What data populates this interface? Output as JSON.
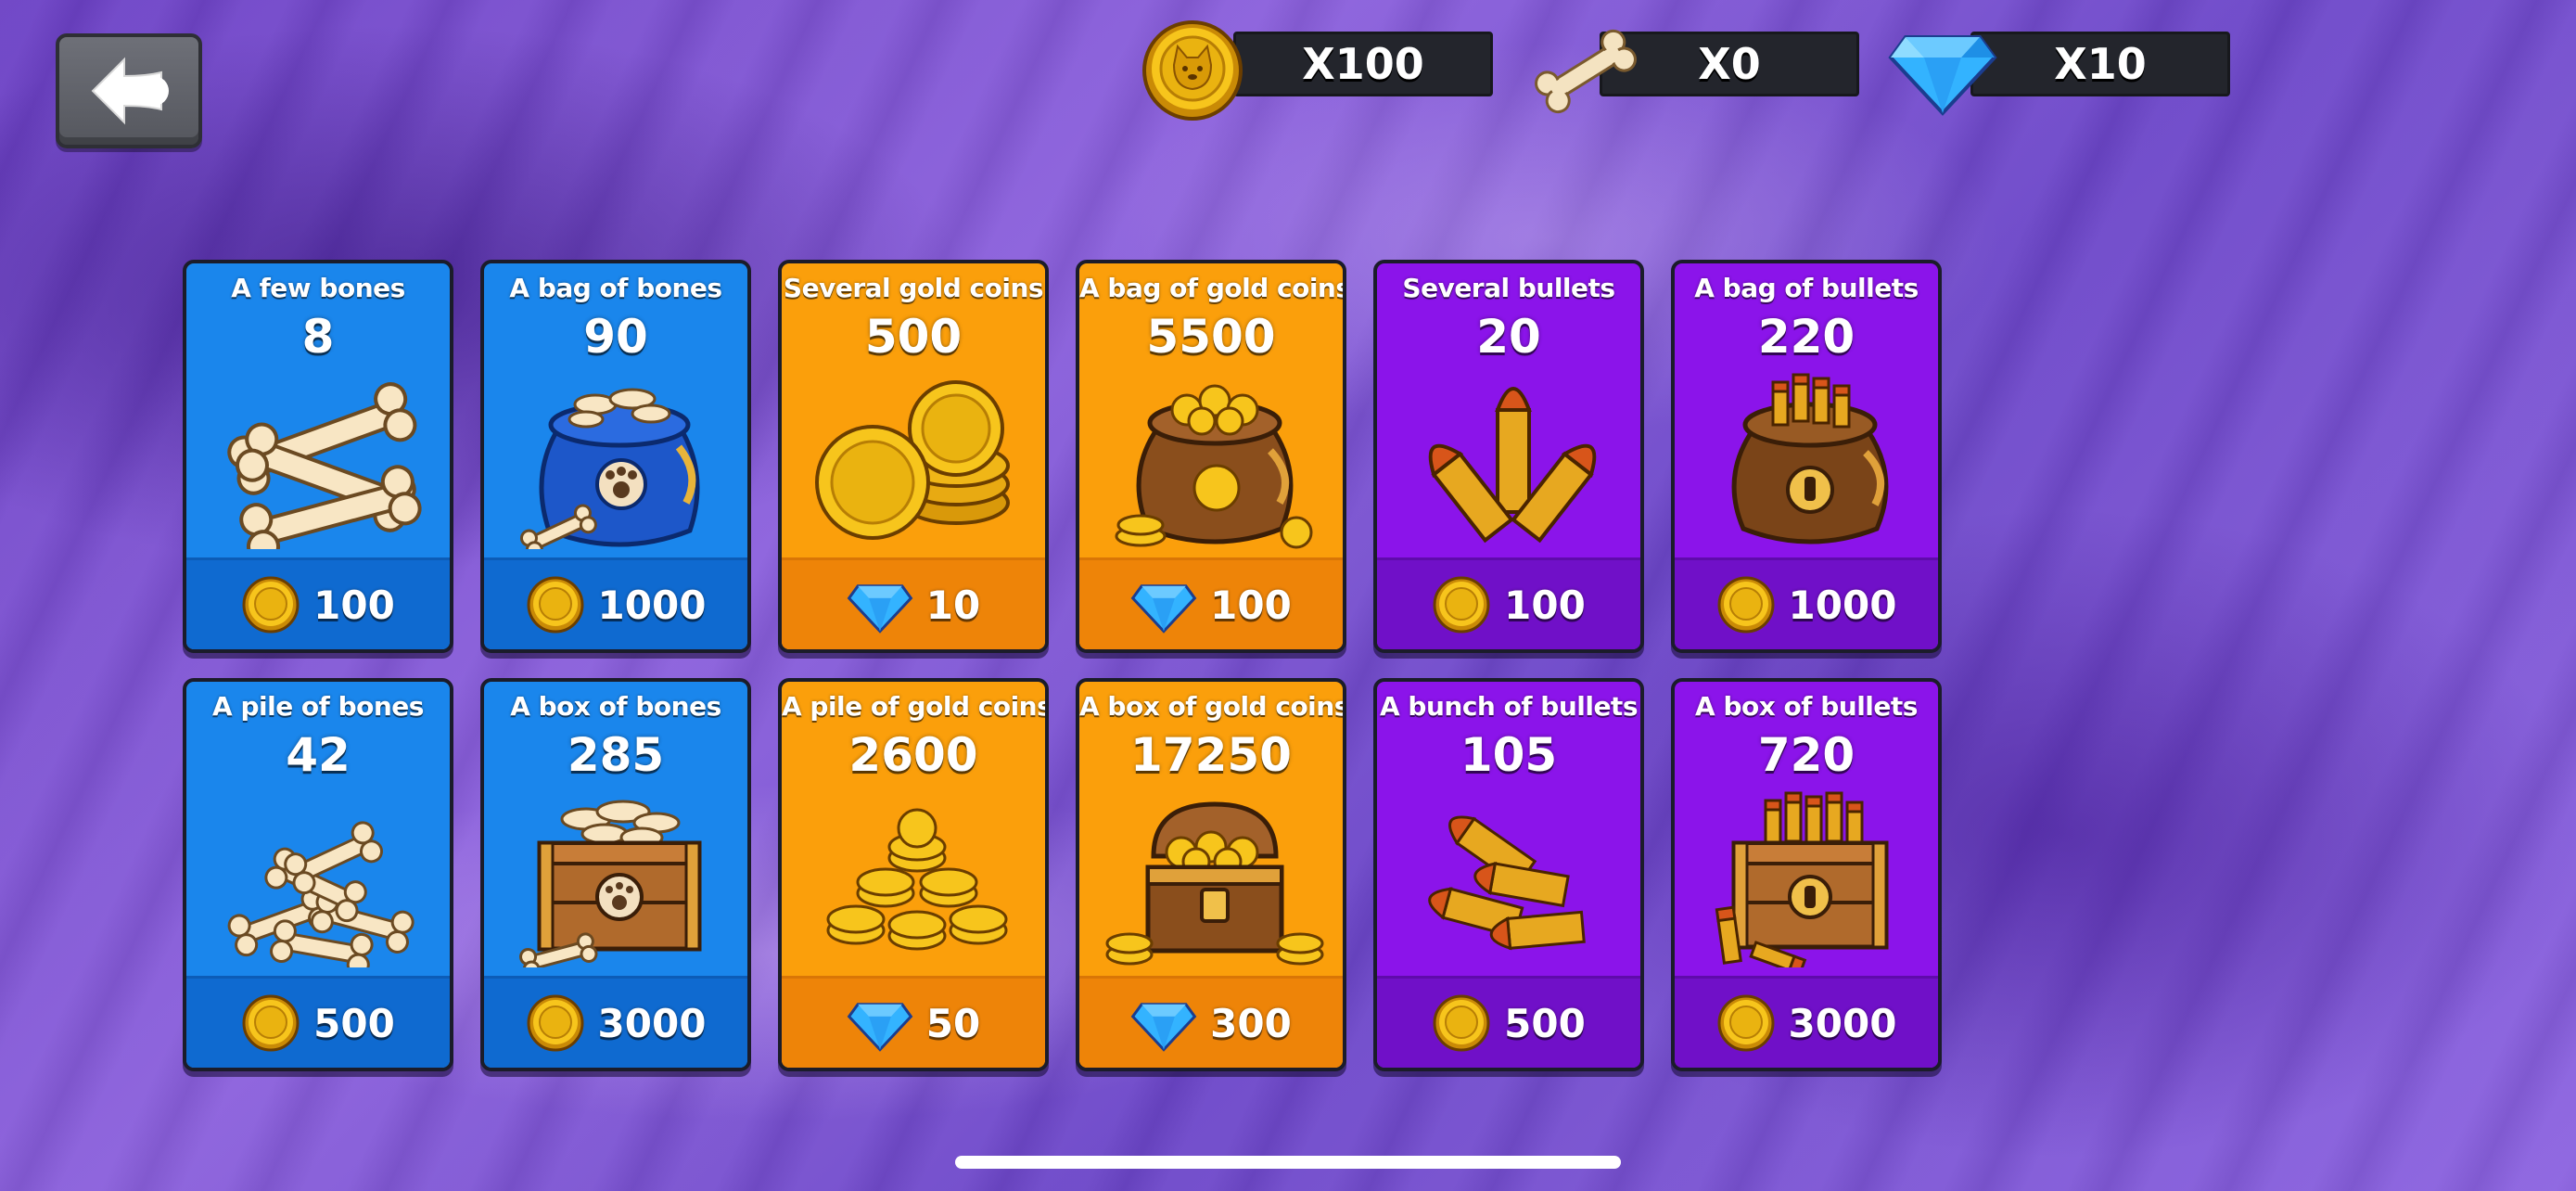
{
  "header": {
    "currencies": [
      {
        "name": "coins",
        "icon": "coin-icon",
        "label": "X100"
      },
      {
        "name": "bones",
        "icon": "bone-icon",
        "label": "X0"
      },
      {
        "name": "gems",
        "icon": "gem-icon",
        "label": "X10"
      }
    ]
  },
  "colors": {
    "blue_card": "#1a86ec",
    "orange_card": "#fb9f0b",
    "purple_card": "#8b14ea"
  },
  "shop": {
    "items": [
      {
        "title": "A few bones",
        "amount": "8",
        "price": "100",
        "currency": "coin-icon",
        "art": "bones-few"
      },
      {
        "title": "A bag of bones",
        "amount": "90",
        "price": "1000",
        "currency": "coin-icon",
        "art": "bones-bag"
      },
      {
        "title": "Several gold coins",
        "amount": "500",
        "price": "10",
        "currency": "gem-icon",
        "art": "coins-several"
      },
      {
        "title": "A bag of gold coins",
        "amount": "5500",
        "price": "100",
        "currency": "gem-icon",
        "art": "coins-bag"
      },
      {
        "title": "Several bullets",
        "amount": "20",
        "price": "100",
        "currency": "coin-icon",
        "art": "bullets-several"
      },
      {
        "title": "A bag of bullets",
        "amount": "220",
        "price": "1000",
        "currency": "coin-icon",
        "art": "bullets-bag"
      },
      {
        "title": "A pile of bones",
        "amount": "42",
        "price": "500",
        "currency": "coin-icon",
        "art": "bones-pile"
      },
      {
        "title": "A box of bones",
        "amount": "285",
        "price": "3000",
        "currency": "coin-icon",
        "art": "bones-box"
      },
      {
        "title": "A pile of gold coins",
        "amount": "2600",
        "price": "50",
        "currency": "gem-icon",
        "art": "coins-pile"
      },
      {
        "title": "A box of gold coins",
        "amount": "17250",
        "price": "300",
        "currency": "gem-icon",
        "art": "coins-chest"
      },
      {
        "title": "A bunch of bullets",
        "amount": "105",
        "price": "500",
        "currency": "coin-icon",
        "art": "bullets-bunch"
      },
      {
        "title": "A box of bullets",
        "amount": "720",
        "price": "3000",
        "currency": "coin-icon",
        "art": "bullets-box"
      }
    ]
  }
}
